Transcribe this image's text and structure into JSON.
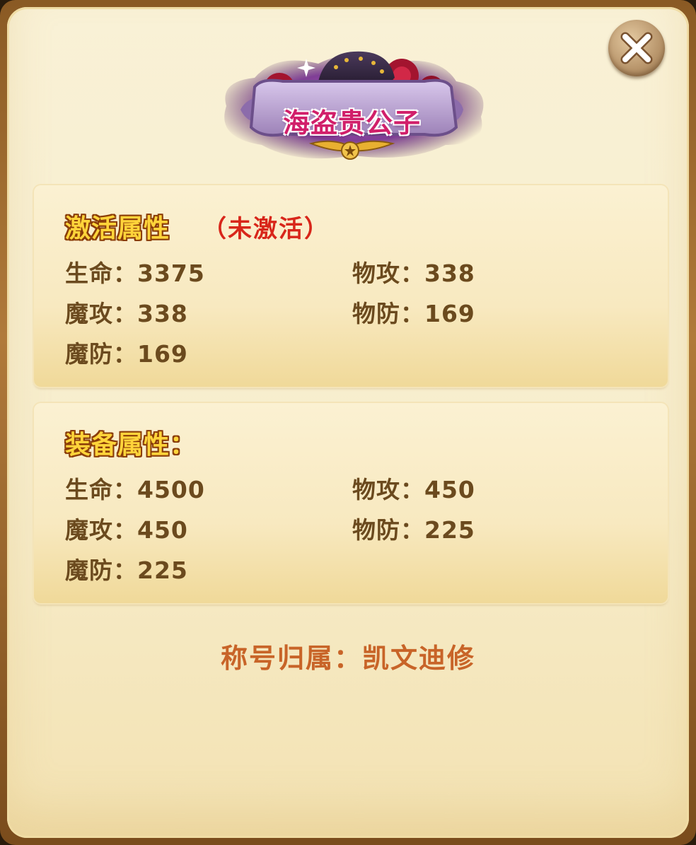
{
  "title_badge": {
    "text": "海盗贵公子",
    "colors": {
      "ribbon": "#b59acb",
      "text": "#c2185b",
      "glow": "#7b2cbf"
    }
  },
  "activate_section": {
    "heading": "激活属性",
    "status": "（未激活）",
    "stats": [
      {
        "label": "生命：",
        "value": "3375"
      },
      {
        "label": "物攻：",
        "value": "338"
      },
      {
        "label": "魔攻：",
        "value": "338"
      },
      {
        "label": "物防：",
        "value": "169"
      },
      {
        "label": "魔防：",
        "value": "169"
      }
    ]
  },
  "equip_section": {
    "heading": "装备属性：",
    "stats": [
      {
        "label": "生命：",
        "value": "4500"
      },
      {
        "label": "物攻：",
        "value": "450"
      },
      {
        "label": "魔攻：",
        "value": "450"
      },
      {
        "label": "物防：",
        "value": "225"
      },
      {
        "label": "魔防：",
        "value": "225"
      }
    ]
  },
  "owner": {
    "label": "称号归属：",
    "name": "凯文迪修"
  },
  "icons": {
    "close": "close-icon"
  }
}
